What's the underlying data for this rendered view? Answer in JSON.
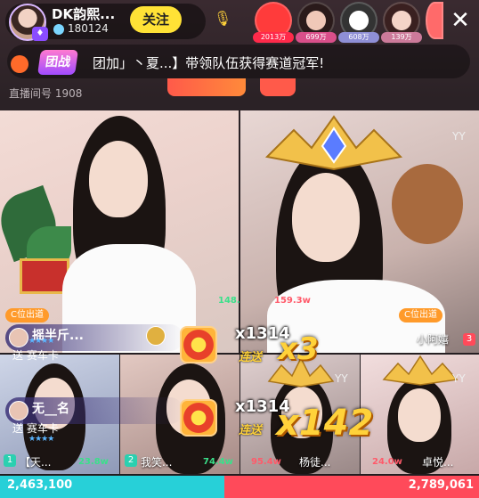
{
  "header": {
    "streamer_name": "DK韵熙...",
    "streamer_fans": "180124",
    "follow_label": "关注",
    "mic_icon": "mic-icon",
    "viewers": [
      {
        "count": "2013万",
        "color": "#ff3b3b"
      },
      {
        "count": "699万",
        "color": "#d94f8a"
      },
      {
        "count": "608万",
        "color": "#8f8fd6"
      },
      {
        "count": "139万",
        "color": "#cc7a9a"
      }
    ],
    "close_label": "✕"
  },
  "banner": {
    "badge_label": "团战",
    "text": "团加」丶夏...】带领队伍获得赛道冠军!"
  },
  "room": {
    "room_number": "直播间号 1908"
  },
  "panels": {
    "top_left": {
      "c_badge": "C位出道",
      "score": "148.3w"
    },
    "top_right": {
      "yy": "YY",
      "score": "159.3w",
      "c_badge": "C位出道",
      "name": "小阿嬉",
      "rank": "3"
    },
    "bottom": [
      {
        "rank": "1",
        "name": "【天...",
        "score": "23.8w",
        "rank_color": "#2ad0b0"
      },
      {
        "rank": "2",
        "name": "我笑...",
        "score": "74.4w",
        "rank_color": "#2ad0b0"
      },
      {
        "rank": "",
        "name": "杨徒...",
        "score": "95.4w",
        "yy": "YY",
        "rank_color": "#ff4a5a"
      },
      {
        "rank": "",
        "name": "卓悦...",
        "score": "24.0w",
        "yy": "YY",
        "rank_color": "#ff4a5a"
      }
    ]
  },
  "gifts": [
    {
      "user": "摇半斤...",
      "action": "送 赛车卡",
      "multiplier": "x1314",
      "combo": "连送",
      "combo_count": "x3"
    },
    {
      "user": "无__名",
      "action": "送 赛车卡",
      "multiplier": "x1314",
      "combo": "连送",
      "combo_count": "x142"
    }
  ],
  "pk": {
    "left_score": "2,463,100",
    "right_score": "2,789,061",
    "left_share": 0.469,
    "left_color": "#27d0d8",
    "right_color": "#ff4a5a"
  }
}
